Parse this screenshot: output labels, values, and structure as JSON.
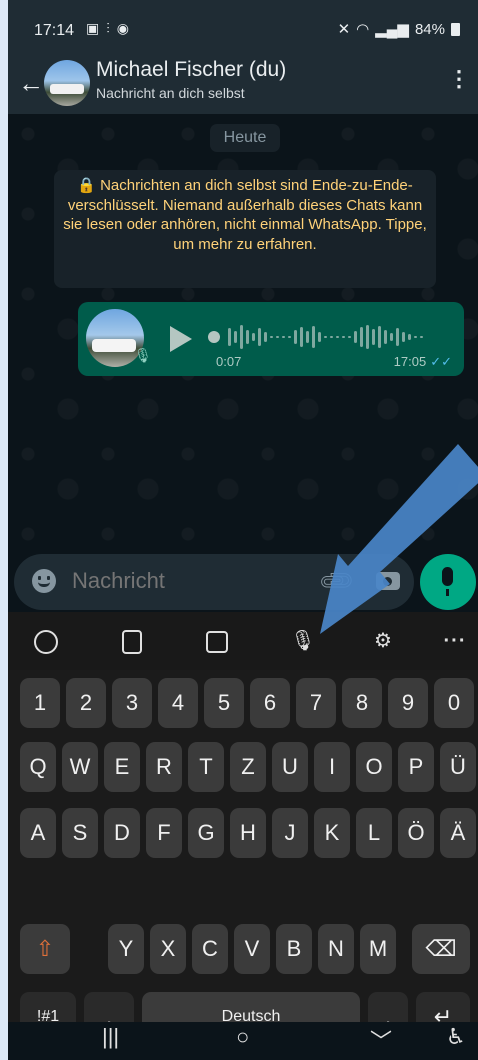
{
  "status_bar": {
    "time": "17:14",
    "left_icons": [
      "gallery-icon",
      "voice-icon",
      "whatsapp-icon"
    ],
    "right_icons": [
      "mute-icon",
      "wifi-icon",
      "signal-icon"
    ],
    "battery": "84%"
  },
  "header": {
    "contact_name": "Michael Fischer (du)",
    "subtitle": "Nachricht an dich selbst"
  },
  "chat": {
    "date_chip": "Heute",
    "e2e_notice": "🔒 Nachrichten an dich selbst sind Ende-zu-Ende-verschlüsselt. Niemand außerhalb dieses Chats kann sie lesen oder anhören, nicht einmal WhatsApp. Tippe, um mehr zu erfahren.",
    "voice_message": {
      "duration": "0:07",
      "time": "17:05",
      "ticks": "✓✓"
    }
  },
  "composer": {
    "placeholder": "Nachricht"
  },
  "keyboard": {
    "number_row": [
      "1",
      "2",
      "3",
      "4",
      "5",
      "6",
      "7",
      "8",
      "9",
      "0"
    ],
    "row1": [
      "Q",
      "W",
      "E",
      "R",
      "T",
      "Z",
      "U",
      "I",
      "O",
      "P",
      "Ü"
    ],
    "row2": [
      "A",
      "S",
      "D",
      "F",
      "G",
      "H",
      "J",
      "K",
      "L",
      "Ö",
      "Ä"
    ],
    "row3": [
      "Y",
      "X",
      "C",
      "V",
      "B",
      "N",
      "M"
    ],
    "symbols_key": "!#1",
    "comma_key": ",",
    "space_label": "Deutsch",
    "period_key": ".",
    "more_tools": "···"
  },
  "colors": {
    "accent": "#00a884",
    "bubble_out": "#005c4b",
    "notice_text": "#ffd279",
    "annotation_arrow": "#4a86c8"
  }
}
